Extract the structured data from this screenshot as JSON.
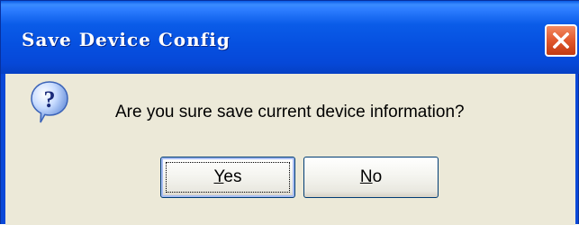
{
  "dialog": {
    "title": "Save Device Config",
    "close_icon": "close-icon",
    "message": "Are you sure save current device information?",
    "icon": "question-icon",
    "buttons": {
      "yes": {
        "accel": "Y",
        "rest": "es"
      },
      "no": {
        "accel": "N",
        "rest": "o"
      }
    }
  },
  "colors": {
    "titlebar": "#0a5ce6",
    "client": "#ece9d8",
    "close_button": "#e1582d",
    "text": "#000000"
  }
}
